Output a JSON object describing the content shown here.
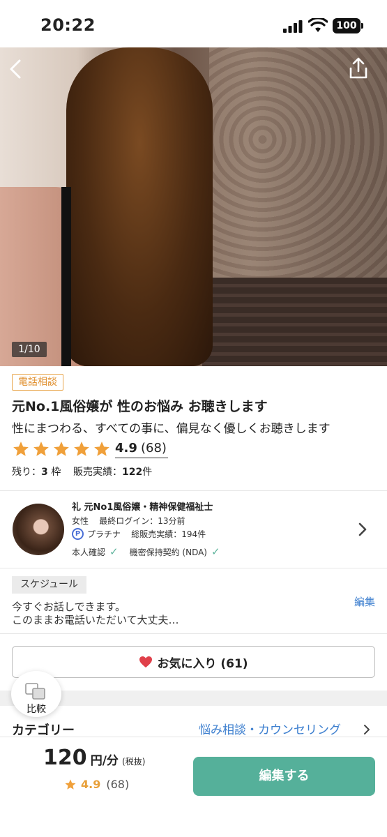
{
  "status_bar": {
    "time": "20:22",
    "battery": "100"
  },
  "hero": {
    "counter": "1/10"
  },
  "listing": {
    "tag": "電話相談",
    "title": "元No.1風俗嬢が 性のお悩み お聴きします",
    "subtitle": "性にまつわる、すべての事に、偏見なく優しくお聴きします",
    "rating": "4.9",
    "rating_count": "(68)",
    "stars": 5,
    "remaining_label": "残り：",
    "remaining_value": "3",
    "remaining_unit": "枠",
    "sales_label": "販売実績：",
    "sales_value": "122",
    "sales_unit": "件"
  },
  "seller": {
    "name": "礼 元No1風俗嬢・精神保健福祉士",
    "gender": "女性",
    "last_login": "最終ログイン：13分前",
    "rank_badge": "P",
    "rank": "プラチナ",
    "total_sales": "総販売実績：194件",
    "verified_identity": "本人確認",
    "verified_nda": "機密保持契約 (NDA)"
  },
  "schedule": {
    "label": "スケジュール",
    "text": "今すぐお話しできます。\nこのままお電話いただいて大丈夫…",
    "edit": "編集"
  },
  "favorite": {
    "label": "お気に入り (61)"
  },
  "compare": {
    "label": "比較"
  },
  "category": {
    "label": "カテゴリー",
    "value": "悩み相談・カウンセリング"
  },
  "bottom_bar": {
    "price": "120",
    "price_unit": "円/分",
    "tax": "(税抜)",
    "rating": "4.9",
    "rating_count": "(68)",
    "cta": "編集する"
  },
  "colors": {
    "accent": "#55b09a",
    "link": "#3d7fcf",
    "star": "#f0a03a",
    "heart": "#e0404a"
  }
}
